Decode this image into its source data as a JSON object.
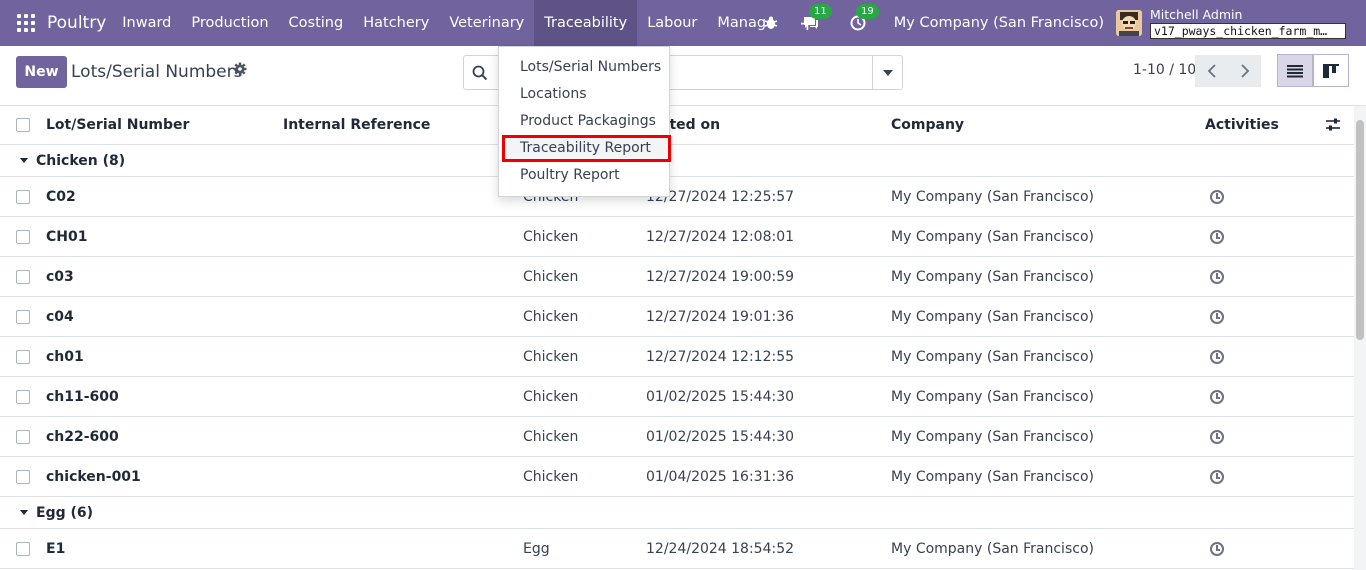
{
  "navbar": {
    "brand": "Poultry",
    "menu": [
      "Inward",
      "Production",
      "Costing",
      "Hatchery",
      "Veterinary",
      "Traceability",
      "Labour",
      "Manage"
    ],
    "active_menu": "Traceability",
    "messages_count": "11",
    "activities_count": "19",
    "company": "My Company (San Francisco)",
    "user_name": "Mitchell Admin",
    "db_name": "v17_pways_chicken_farm_m…"
  },
  "control": {
    "new_label": "New",
    "title": "Lots/Serial Numbers",
    "pager": "1-10 / 10"
  },
  "dropdown": {
    "items": [
      "Lots/Serial Numbers",
      "Locations",
      "Product Packagings",
      "Traceability Report",
      "Poultry Report"
    ]
  },
  "table": {
    "headers": {
      "lot": "Lot/Serial Number",
      "internal_ref": "Internal Reference",
      "created": "Created on",
      "created_visible": "ated on",
      "company": "Company",
      "activities": "Activities"
    },
    "groups": [
      {
        "label": "Chicken (8)",
        "rows": [
          {
            "lot": "C02",
            "product": "Chicken",
            "created": "12/27/2024 12:25:57",
            "company": "My Company (San Francisco)"
          },
          {
            "lot": "CH01",
            "product": "Chicken",
            "created": "12/27/2024 12:08:01",
            "company": "My Company (San Francisco)"
          },
          {
            "lot": "c03",
            "product": "Chicken",
            "created": "12/27/2024 19:00:59",
            "company": "My Company (San Francisco)"
          },
          {
            "lot": "c04",
            "product": "Chicken",
            "created": "12/27/2024 19:01:36",
            "company": "My Company (San Francisco)"
          },
          {
            "lot": "ch01",
            "product": "Chicken",
            "created": "12/27/2024 12:12:55",
            "company": "My Company (San Francisco)"
          },
          {
            "lot": "ch11-600",
            "product": "Chicken",
            "created": "01/02/2025 15:44:30",
            "company": "My Company (San Francisco)"
          },
          {
            "lot": "ch22-600",
            "product": "Chicken",
            "created": "01/02/2025 15:44:30",
            "company": "My Company (San Francisco)"
          },
          {
            "lot": "chicken-001",
            "product": "Chicken",
            "created": "01/04/2025 16:31:36",
            "company": "My Company (San Francisco)"
          }
        ]
      },
      {
        "label": "Egg (6)",
        "rows": [
          {
            "lot": "E1",
            "product": "Egg",
            "created": "12/24/2024 18:54:52",
            "company": "My Company (San Francisco)"
          }
        ]
      }
    ]
  }
}
